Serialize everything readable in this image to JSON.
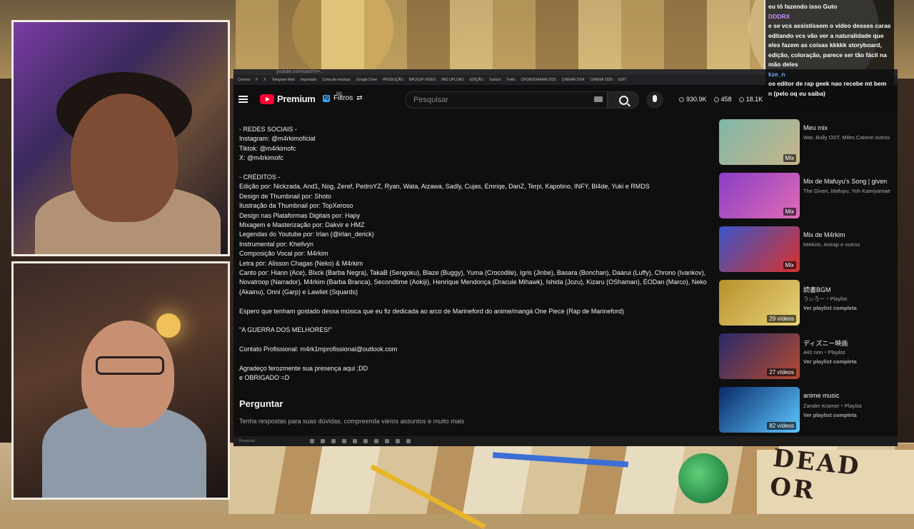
{
  "youtube": {
    "url": "youtube.com/watch?v=...",
    "bookmarks": [
      "Cinema",
      "F",
      "X",
      "Telegram Web",
      "Importado",
      "Coisa de músicas",
      "Google Drive",
      "PRODUÇÃO",
      "BACKUP VIDEO",
      "IMG UPLOAD",
      "EDIÇÃO",
      "Tudoist",
      "Trello",
      "CRONOGRAMA 2025",
      "CINEMA 2024",
      "CINEMA 2025",
      "EDIT"
    ],
    "logo_text": "Premium",
    "logo_region": "BR",
    "filter_label": "Filtros",
    "search_placeholder": "Pesquisar",
    "stats": {
      "views": "930.9K",
      "likes": "458",
      "watching": "18.1K"
    }
  },
  "description": {
    "redes_header": "- REDES SOCIAIS -",
    "instagram": "Instagram: @m4rkimoficial",
    "tiktok": "Tiktok: @m4rkimofc",
    "x": "X: @m4rkimofc",
    "creditos_header": "- CRÉDITOS -",
    "credits": [
      "Edição por: Nickzada, And1, Nog, Zeref, PedroYZ, Ryan, Wata, Aizawa, Sadly, Cujas, Emriqe, DanZ, Terpi, Kapotino, INFY, Bl4de, Yuki e RMDS",
      "Design de Thumbnail por: Shoto",
      "Ilustração da Thumbnail por: TopXeroso",
      "Design nas Plataformas Digitais por: Hapy",
      "Mixagem e Masterização por: Dakvir e HMZ",
      "Legendas do Youtube por: Irlan (@irlan_derick)",
      "Instrumental por: Khellvyn",
      "Composição Vocal por: M4rkim",
      "Letra por: Alisson Chagas (Neko) & M4rkim",
      "Canto por: Hiann (Ace), Blxck (Barba Negra), TakaB (Sengoku), Blaze (Buggy), Yuma (Crocodile), Igris (Jinbe), Basara (Bonchan), Daarui (Luffy), Chrono (Ivankov), Novatroop (Narrador), M4rkim (Barba Branca), Secondtime (Aokiji), Henrique Mendonça (Dracule Mihawk), Ishida (Jozu), Kizaru (OShaman), ÉODan (Marco), Neko (Akainu), Onni (Garp) e Lawliet (Squards)"
    ],
    "dedication": "Espero que tenham gostado dessa música que eu fiz dedicada ao arco de Marineford do anime/mangá One Piece (Rap de Marineford)",
    "tagline": "\"A GUERRA DOS MELHORES!\"",
    "contact": "Contato Profissional: m4rk1mprofissional@outlook.com",
    "thanks1": "Agradeço ferozmente sua presença aqui ;DD",
    "thanks2": "e OBRIGADO =D"
  },
  "perguntar": {
    "title": "Perguntar",
    "subtitle": "Tenha respostas para suas dúvidas, compreenda vários assuntos e muito mais"
  },
  "taskbar": {
    "search": "Pesquisar"
  },
  "sidebar": [
    {
      "title": "Meu mix",
      "sub": "War, Bully OST, Miles Catone outros",
      "link": "",
      "badge": "Mix",
      "color1": "#7fb7a8",
      "color2": "#c9b48a"
    },
    {
      "title": "Mix de Mafuyu's Song | given",
      "sub": "The Given, Mafuyu, Yoh Kamiyamae",
      "link": "",
      "badge": "Mix",
      "color1": "#8a3ec7",
      "color2": "#e06bb4"
    },
    {
      "title": "Mix de M4rkim",
      "sub": "M4rkim, Anirap e outros",
      "link": "",
      "badge": "Mix",
      "color1": "#3a55c8",
      "color2": "#d8322b"
    },
    {
      "title": "読書BGM",
      "sub": "うぃろー・Playlist",
      "link": "Ver playlist completa",
      "badge": "29 vídeos",
      "color1": "#b8912c",
      "color2": "#e8d27a"
    },
    {
      "title": "ディズニー映画",
      "sub": "440 nnn・Playlist",
      "link": "Ver playlist completa",
      "badge": "27 vídeos",
      "color1": "#2a2a6b",
      "color2": "#b44b2f"
    },
    {
      "title": "anime music",
      "sub": "Zander Kramer・Playlist",
      "link": "Ver playlist completa",
      "badge": "82 vídeos",
      "color1": "#0a2a6a",
      "color2": "#5ec8ff"
    }
  ],
  "chat": {
    "msg0": "eu tô fazendo isso Guto",
    "user1": "DDDRX",
    "msg1": "e se vcs assistissem o vídeo desses caras editando vcs vão ver a naturalidade que eles fazem as coisas kkkkk storyboard, edição, coloração, parece ser tão fácil na mão deles",
    "user2": "kze_n",
    "msg2": "os editor de rap geek nao recebe mt bem n (pelo oq eu saiba)"
  },
  "background": {
    "poster_text": "DEAD OR"
  }
}
